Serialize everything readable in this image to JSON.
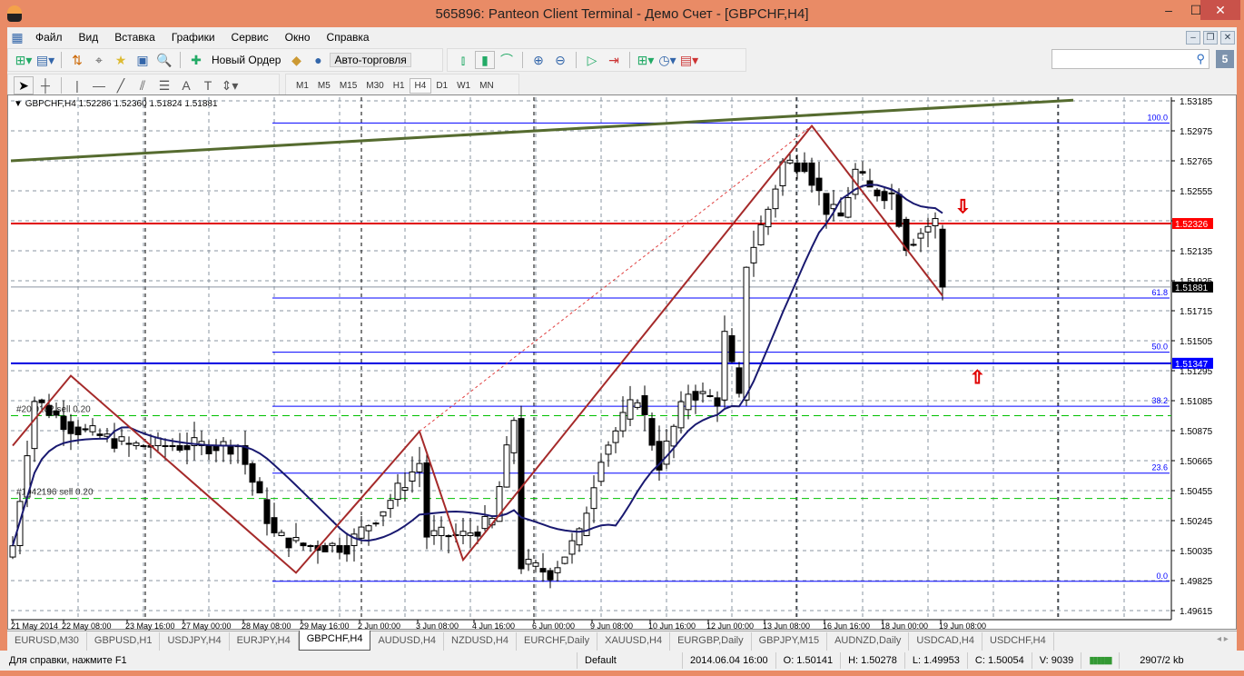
{
  "window": {
    "title": "565896: Panteon Client Terminal - Демо Счет - [GBPCHF,H4]",
    "min": "–",
    "max": "☐",
    "close": "✕"
  },
  "menu": [
    "Файл",
    "Вид",
    "Вставка",
    "Графики",
    "Сервис",
    "Окно",
    "Справка"
  ],
  "toolbar": {
    "new_order": "Новый Ордер",
    "auto_trading": "Авто-торговля",
    "search_placeholder": "",
    "badge": "5"
  },
  "timeframes": [
    "M1",
    "M5",
    "M15",
    "M30",
    "H1",
    "H4",
    "D1",
    "W1",
    "MN"
  ],
  "active_timeframe": "H4",
  "chart_info": "GBPCHF,H4  1.52286 1.52360 1.51824 1.51881",
  "chart_data": {
    "type": "candlestick",
    "symbol": "GBPCHF",
    "timeframe": "H4",
    "ohlc_last": {
      "open": 1.52286,
      "high": 1.5236,
      "low": 1.51824,
      "close": 1.51881
    },
    "price_ticks": [
      "1.53185",
      "1.52975",
      "1.52765",
      "1.52555",
      "1.52345",
      "1.52135",
      "1.51925",
      "1.51715",
      "1.51505",
      "1.51295",
      "1.51085",
      "1.50875",
      "1.50665",
      "1.50455",
      "1.50245",
      "1.50035",
      "1.49825",
      "1.49615"
    ],
    "ylim": [
      1.49615,
      1.53185
    ],
    "time_labels": [
      "21 May 2014",
      "22 May 08:00",
      "23 May 16:00",
      "27 May 00:00",
      "28 May 08:00",
      "29 May 16:00",
      "2 Jun 00:00",
      "3 Jun 08:00",
      "4 Jun 16:00",
      "6 Jun 00:00",
      "9 Jun 08:00",
      "10 Jun 16:00",
      "12 Jun 00:00",
      "13 Jun 08:00",
      "16 Jun 16:00",
      "18 Jun 00:00",
      "19 Jun 08:00"
    ],
    "close_path": [
      [
        0,
        1.5007
      ],
      [
        3,
        1.5109
      ],
      [
        8,
        1.509
      ],
      [
        16,
        1.5077
      ],
      [
        23,
        1.5077
      ],
      [
        31,
        1.5077
      ],
      [
        36,
        1.5014
      ],
      [
        40,
        1.5007
      ],
      [
        46,
        1.5007
      ],
      [
        51,
        1.5033
      ],
      [
        56,
        1.5065
      ],
      [
        57,
        1.5014
      ],
      [
        62,
        1.5014
      ],
      [
        66,
        1.5024
      ],
      [
        69,
        1.5096
      ],
      [
        70,
        1.4994
      ],
      [
        74,
        1.4988
      ],
      [
        78,
        1.5014
      ],
      [
        81,
        1.5071
      ],
      [
        86,
        1.5112
      ],
      [
        89,
        1.5064
      ],
      [
        93,
        1.5115
      ],
      [
        97,
        1.5109
      ],
      [
        98,
        1.5154
      ],
      [
        100,
        1.5109
      ],
      [
        101,
        1.5205
      ],
      [
        104,
        1.5243
      ],
      [
        106,
        1.5275
      ],
      [
        109,
        1.5275
      ],
      [
        112,
        1.5243
      ],
      [
        114,
        1.5237
      ],
      [
        116,
        1.5269
      ],
      [
        118,
        1.5256
      ],
      [
        121,
        1.5253
      ],
      [
        123,
        1.5218
      ],
      [
        126,
        1.5231
      ],
      [
        127,
        1.5234
      ],
      [
        128,
        1.51881
      ]
    ],
    "bid_price": "1.51881",
    "levels": {
      "red": "1.52326",
      "blue": "1.51347"
    },
    "trendline": [
      [
        0,
        1.52765
      ],
      [
        146,
        1.5319
      ]
    ],
    "zigzag": [
      [
        0,
        1.5077
      ],
      [
        8,
        1.5126
      ],
      [
        39,
        1.4988
      ],
      [
        56,
        1.5087
      ],
      [
        62,
        1.4997
      ],
      [
        110,
        1.5301
      ],
      [
        128,
        1.5182
      ]
    ],
    "dashed_link": [
      [
        56,
        1.5087
      ],
      [
        110,
        1.5301
      ]
    ],
    "fibonacci": {
      "p0": 1.4982,
      "p100": 1.5303,
      "levels": [
        "0.0",
        "23.6",
        "38.2",
        "50.0",
        "61.8",
        "100.0"
      ]
    },
    "orders": [
      {
        "label": "#20 9182 sell 0.20",
        "price": 1.5098
      },
      {
        "label": "#1042196 sell 0.20",
        "price": 1.504
      }
    ],
    "ma_period": 14,
    "colors": {
      "red": "#e00000",
      "blue": "#0000e0",
      "zigzag": "#a52a2a",
      "trend": "#556b2f",
      "ma": "#191970",
      "fib": "#0000ff",
      "order": "#00c000"
    }
  },
  "tabs": [
    "EURUSD,M30",
    "GBPUSD,H1",
    "USDJPY,H4",
    "EURJPY,H4",
    "GBPCHF,H4",
    "AUDUSD,H4",
    "NZDUSD,H4",
    "EURCHF,Daily",
    "XAUUSD,H4",
    "EURGBP,Daily",
    "GBPJPY,M15",
    "AUDNZD,Daily",
    "USDCAD,H4",
    "USDCHF,H4"
  ],
  "active_tab": "GBPCHF,H4",
  "status": {
    "help": "Для справки, нажмите F1",
    "profile": "Default",
    "time": "2014.06.04 16:00",
    "open": "O: 1.50141",
    "high": "H: 1.50278",
    "low": "L: 1.49953",
    "close": "C: 1.50054",
    "volume": "V: 9039",
    "traffic": "2907/2 kb"
  }
}
